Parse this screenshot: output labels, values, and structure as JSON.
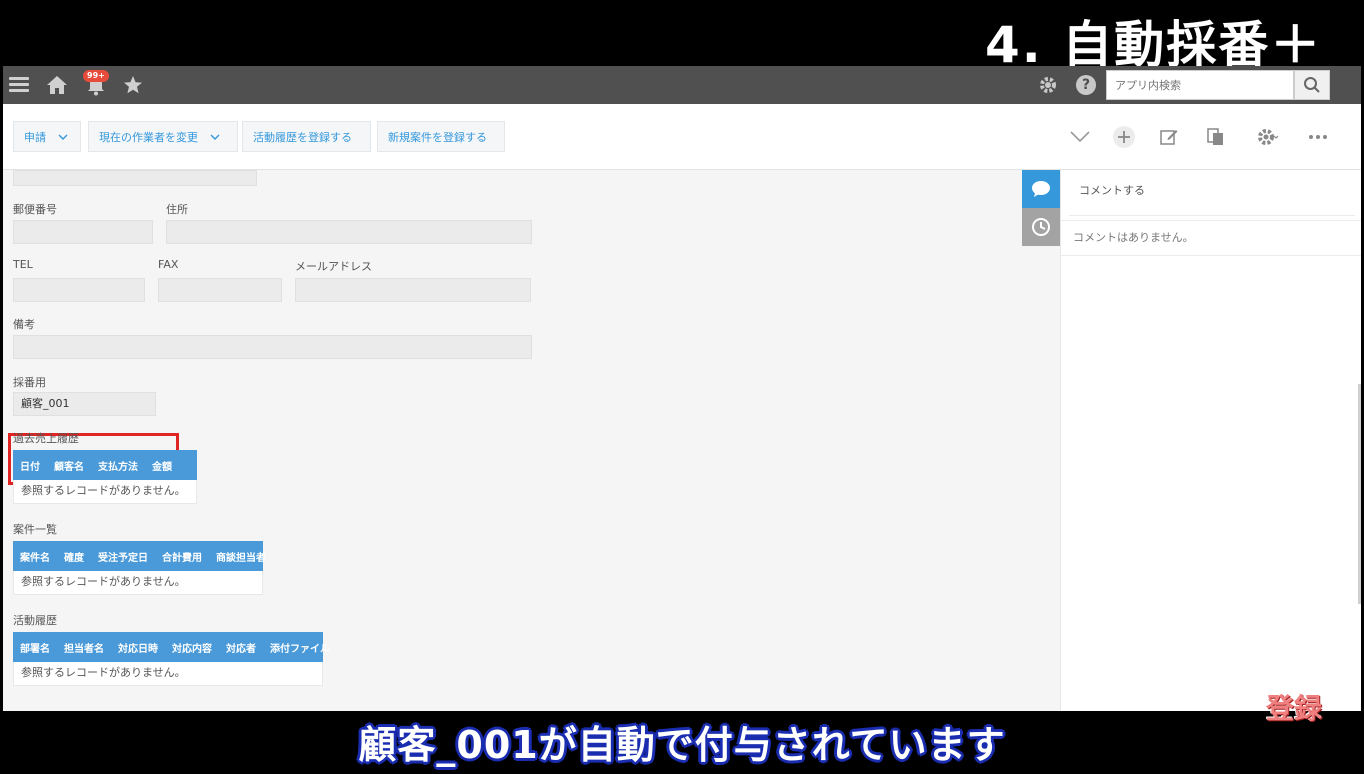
{
  "overlay": {
    "title": "4. 自動採番＋",
    "register_badge": "登録"
  },
  "subtitle": "顧客_001が自動で付与されています",
  "header": {
    "badge": "99+",
    "search_placeholder": "アプリ内検索"
  },
  "toolbar": {
    "buttons": [
      "申請",
      "現在の作業者を変更",
      "活動履歴を登録する",
      "新規案件を登録する"
    ]
  },
  "form": {
    "postal_label": "郵便番号",
    "address_label": "住所",
    "tel_label": "TEL",
    "fax_label": "FAX",
    "email_label": "メールアドレス",
    "notes_label": "備考",
    "numbering_label": "採番用",
    "numbering_value": "顧客_001"
  },
  "tables": [
    {
      "title": "過去売上履歴",
      "columns": [
        "日付",
        "顧客名",
        "支払方法",
        "金額"
      ],
      "empty": "参照するレコードがありません。"
    },
    {
      "title": "案件一覧",
      "columns": [
        "案件名",
        "確度",
        "受注予定日",
        "合計費用",
        "商談担当者"
      ],
      "empty": "参照するレコードがありません。"
    },
    {
      "title": "活動履歴",
      "columns": [
        "部署名",
        "担当者名",
        "対応日時",
        "対応内容",
        "対応者",
        "添付ファイル"
      ],
      "empty": "参照するレコードがありません。"
    }
  ],
  "comments": {
    "input_placeholder": "コメントする",
    "none": "コメントはありません。"
  },
  "colors": {
    "accent": "#3498db",
    "header": "#505050",
    "highlight": "#e02424",
    "subtitle_outline": "#1a2db0"
  }
}
